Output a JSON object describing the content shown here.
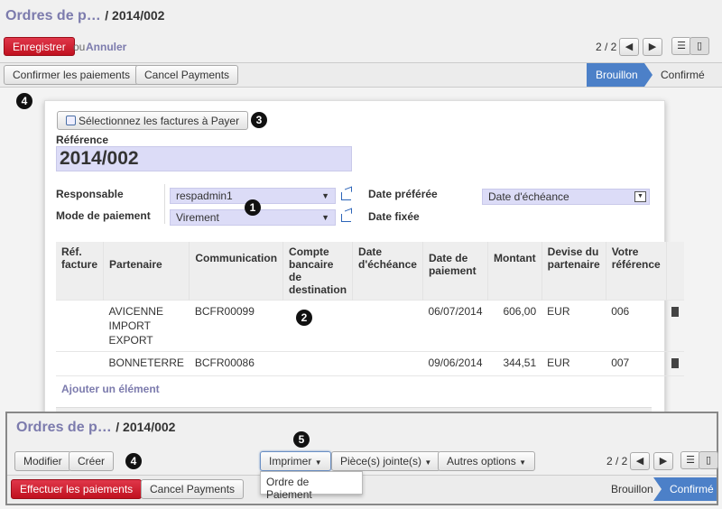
{
  "top": {
    "title_prefix": "Ordres de p…",
    "title_record": "/ 2014/002",
    "save_label": "Enregistrer",
    "or_label": "ou",
    "cancel_label": "Annuler",
    "pager": "2 / 2"
  },
  "statusbar": {
    "confirm_payments": "Confirmer les paiements",
    "cancel_payments": "Cancel Payments",
    "stages": [
      "Brouillon",
      "Confirmé"
    ]
  },
  "form": {
    "select_invoices": "Sélectionnez les factures à Payer",
    "reference_label": "Référence",
    "reference_value": "2014/002",
    "responsible_label": "Responsable",
    "responsible_value": "respadmin1",
    "payment_mode_label": "Mode de paiement",
    "payment_mode_value": "Virement",
    "preferred_date_label": "Date préférée",
    "preferred_date_value": "Date d'échéance",
    "fixed_date_label": "Date fixée"
  },
  "lines": {
    "headers": [
      "Réf. facture",
      "Partenaire",
      "Communication",
      "Compte bancaire de destination",
      "Date d'échéance",
      "Date de paiement",
      "Montant",
      "Devise du partenaire",
      "Votre référence"
    ],
    "rows": [
      {
        "ref": "",
        "partner": "AVICENNE IMPORT EXPORT",
        "communication": "BCFR00099",
        "account": "",
        "due_date": "",
        "payment_date": "06/07/2014",
        "amount": "606,00",
        "currency": "EUR",
        "your_ref": "006"
      },
      {
        "ref": "",
        "partner": "BONNETERRE",
        "communication": "BCFR00086",
        "account": "",
        "due_date": "",
        "payment_date": "09/06/2014",
        "amount": "344,51",
        "currency": "EUR",
        "your_ref": "007"
      }
    ],
    "add_item": "Ajouter un élément"
  },
  "callouts": [
    "1",
    "2",
    "3",
    "4",
    "4",
    "5"
  ],
  "bottom": {
    "title_prefix": "Ordres de p…",
    "title_record": "/ 2014/002",
    "edit_label": "Modifier",
    "create_label": "Créer",
    "print_label": "Imprimer",
    "attachments_label": "Pièce(s) jointe(s)",
    "more_label": "Autres options",
    "print_menu_item": "Ordre de Paiement",
    "pager": "2 / 2",
    "do_payments": "Effectuer les paiements",
    "cancel_payments": "Cancel Payments",
    "stages": [
      "Brouillon",
      "Confirmé"
    ]
  },
  "colors": {
    "accent": "#7c7bad",
    "primary_red": "#c0111f",
    "stage_active": "#4c80c8",
    "field_bg": "#dcdcf7"
  }
}
